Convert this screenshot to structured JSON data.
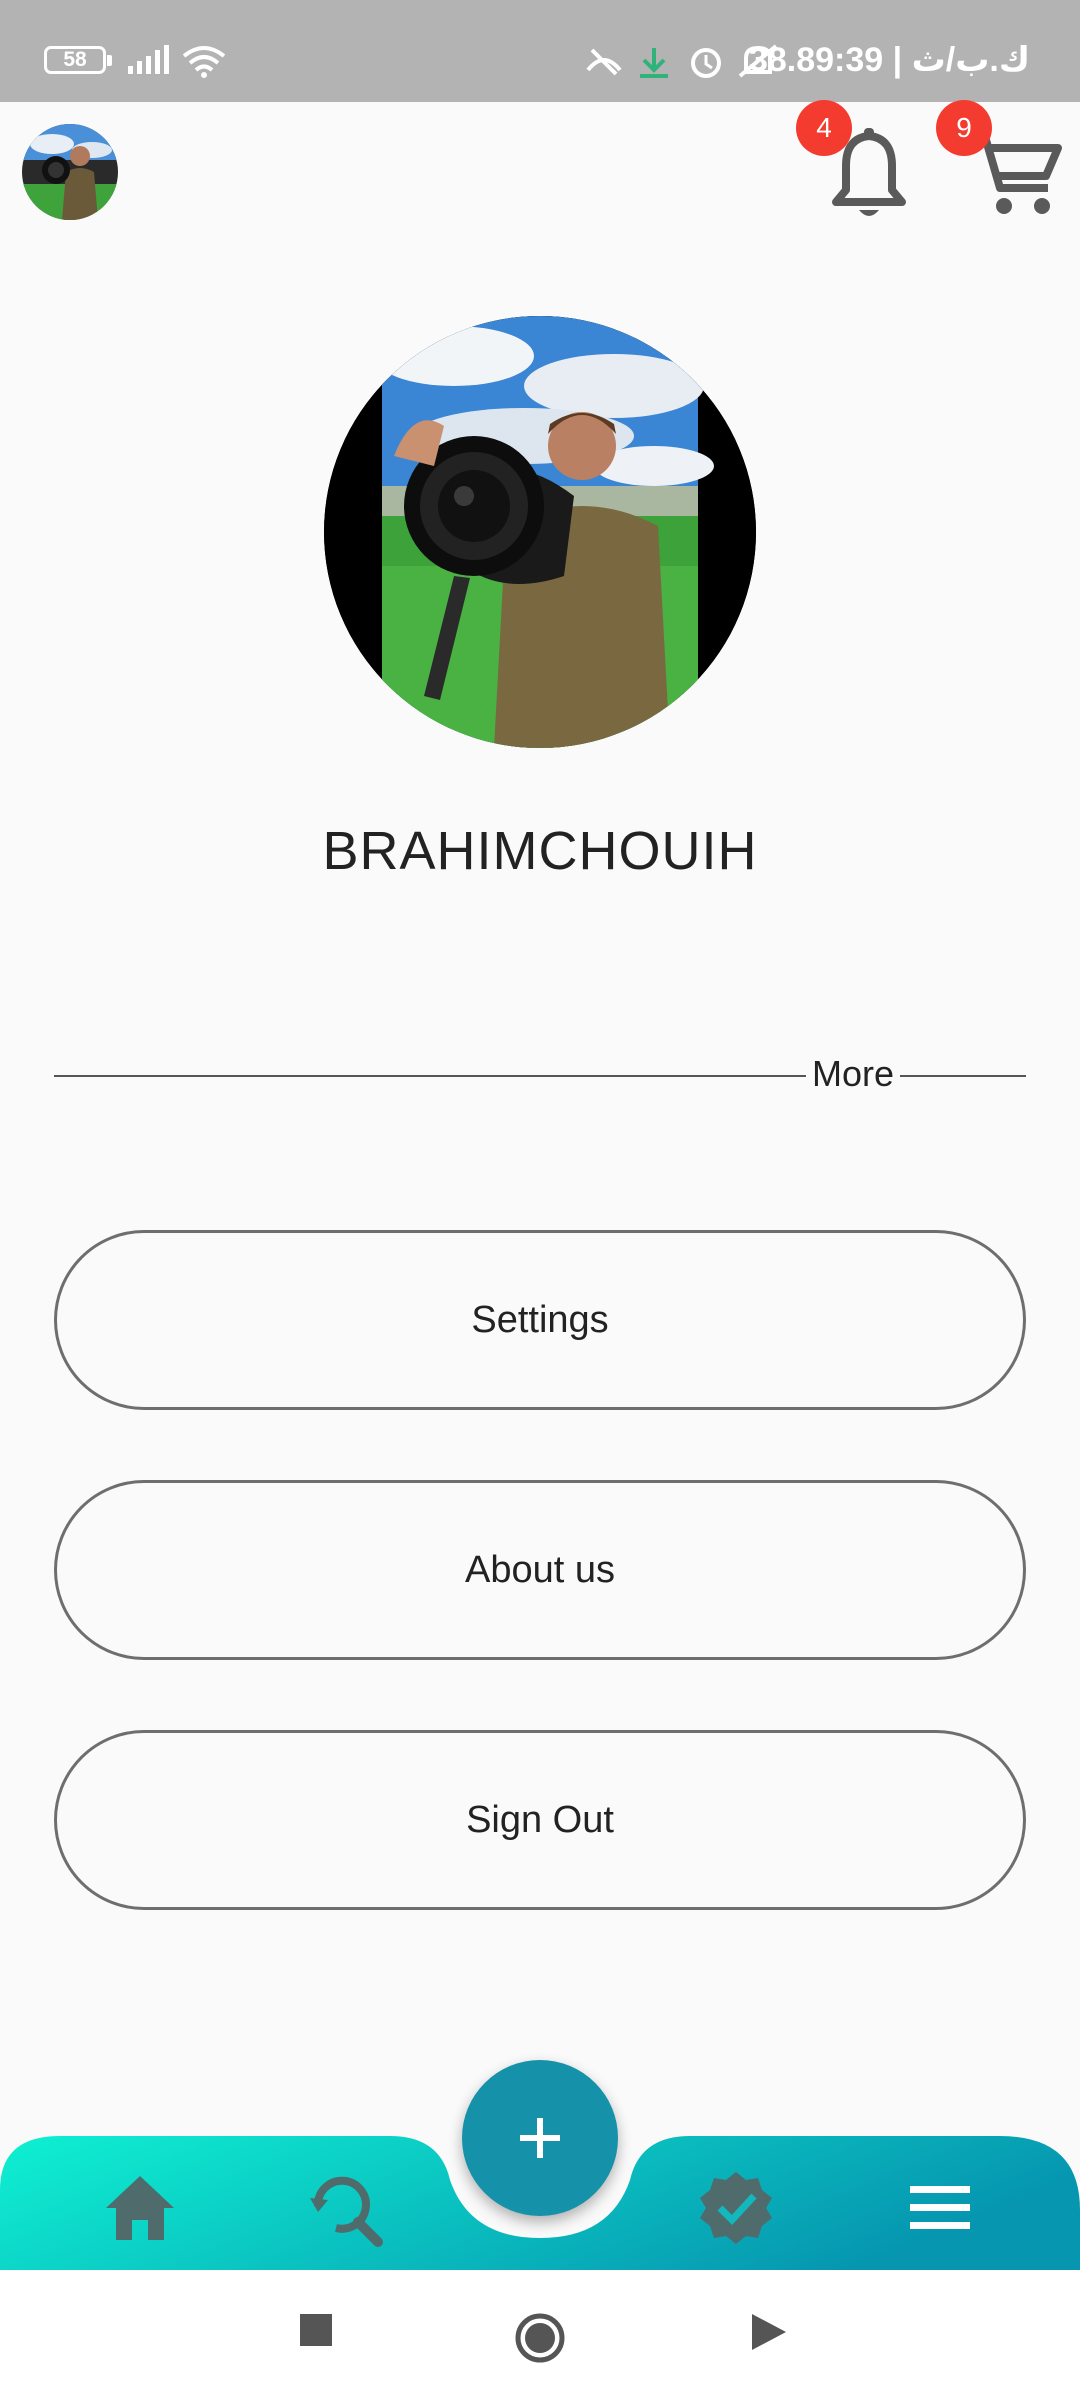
{
  "status_bar": {
    "battery": "58",
    "text": "38.8ك.ب/ث | 9:39"
  },
  "header": {
    "notifications_count": "4",
    "cart_count": "9"
  },
  "profile": {
    "username": "BRAHIMCHOUIH"
  },
  "divider": {
    "label": "More"
  },
  "menu": {
    "settings": "Settings",
    "about": "About us",
    "sign_out": "Sign Out"
  },
  "icons": {
    "top": [
      "avatar",
      "bell-icon",
      "cart-icon"
    ],
    "nav": [
      "home-icon",
      "search-history-icon",
      "verified-icon",
      "menu-icon"
    ],
    "fab": "plus-icon",
    "system": [
      "square-icon",
      "circle-icon",
      "triangle-icon"
    ]
  },
  "colors": {
    "accent_start": "#0ff0d2",
    "accent_end": "#0696b0",
    "fab": "#1592aa",
    "badge": "#f43b30"
  }
}
